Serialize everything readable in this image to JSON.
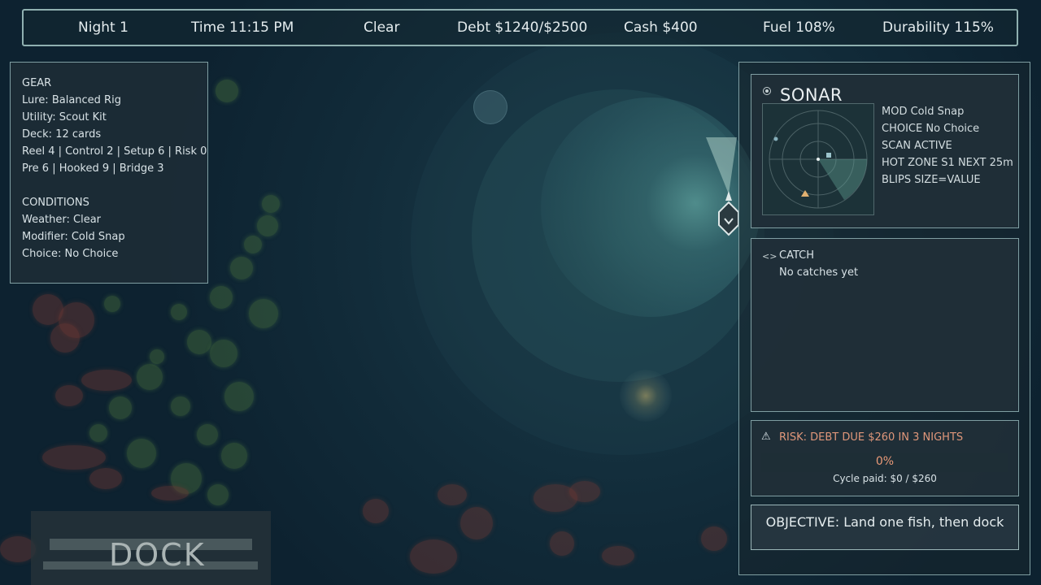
{
  "hud": {
    "night": "Night 1",
    "time": "Time 11:15 PM",
    "weather": "Clear",
    "debt": "Debt $1240/$2500",
    "cash": "Cash $400",
    "fuel": "Fuel 108%",
    "durability": "Durability 115%"
  },
  "gear_panel": {
    "gear_heading": "GEAR",
    "lure": "Lure: Balanced Rig",
    "utility": "Utility: Scout Kit",
    "deck": "Deck: 12 cards",
    "stats_line_1": "Reel 4 | Control 2 | Setup 6 | Risk 0",
    "stats_line_2": "Pre 6 | Hooked 9 | Bridge 3",
    "conditions_heading": "CONDITIONS",
    "weather": "Weather: Clear",
    "modifier": "Modifier: Cold Snap",
    "choice": "Choice: No Choice"
  },
  "sonar": {
    "title": "SONAR",
    "icon": "sonar-icon",
    "mod": "MOD  Cold Snap",
    "choice": "CHOICE  No Choice",
    "scan": "SCAN  ACTIVE",
    "hot_zone": "HOT ZONE S1  NEXT 25m",
    "blips": "BLIPS  SIZE=VALUE"
  },
  "catch": {
    "title": "CATCH",
    "icon": "fish-icon",
    "empty_text": "No catches yet"
  },
  "risk": {
    "title": "RISK: DEBT DUE $260 IN 3 NIGHTS",
    "icon": "warning-icon",
    "progress_label": "0%",
    "progress_fraction": 0,
    "cycle_text": "Cycle paid: $0 / $260",
    "accent_color": "#e0977a"
  },
  "objective": {
    "text": "OBJECTIVE: Land one fish, then dock"
  },
  "dock": {
    "label": "DOCK"
  },
  "colors": {
    "water": "#0d2230",
    "panel_border": "#7f9ea2",
    "lily_pad": "#466e3c",
    "risk_accent": "#e0977a"
  }
}
